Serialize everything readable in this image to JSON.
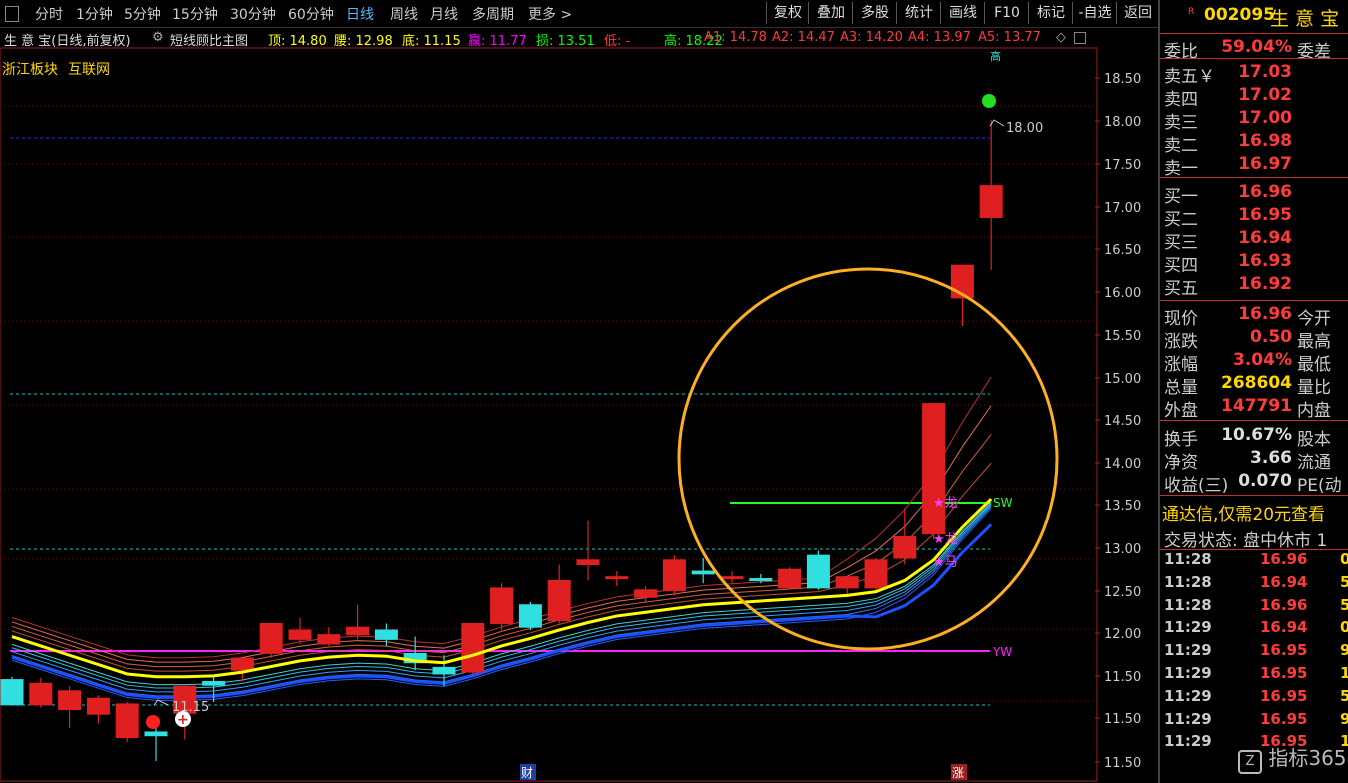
{
  "toolbar": {
    "periods": [
      "分时",
      "1分钟",
      "5分钟",
      "15分钟",
      "30分钟",
      "60分钟",
      "日线",
      "周线",
      "月线",
      "多周期",
      "更多 >"
    ],
    "active_period": "日线",
    "buttons": [
      "复权",
      "叠加",
      "多股",
      "统计",
      "画线",
      "F10",
      "标记",
      "-自选",
      "返回"
    ]
  },
  "info": {
    "title": "生 意 宝(日线,前复权)",
    "indicator": "短线顾比主图",
    "items": [
      {
        "text": "顶: 14.80",
        "color": "#ffff00"
      },
      {
        "text": "腰: 12.98",
        "color": "#ffff00"
      },
      {
        "text": "底: 11.15",
        "color": "#ffff00"
      },
      {
        "text": "赢: 11.77",
        "color": "#ff00ff"
      },
      {
        "text": "损: 13.51",
        "color": "#00ff00"
      },
      {
        "text": "低: -",
        "color": "#ff3b3b"
      },
      {
        "text": "高: 18.22",
        "color": "#00ff00"
      },
      {
        "text": "A1: 14.78",
        "color": "#ff3b3b"
      },
      {
        "text": "A2: 14.47",
        "color": "#ff3b3b"
      },
      {
        "text": "A3: 14.20",
        "color": "#ff3b3b"
      },
      {
        "text": "A4: 13.97",
        "color": "#ff3b3b"
      },
      {
        "text": "A5: 13.77",
        "color": "#ff3b3b"
      }
    ]
  },
  "sectors": [
    "浙江板块",
    "互联网"
  ],
  "chart_data": {
    "type": "candlestick",
    "ylim": [
      11.0,
      18.75
    ],
    "y_ticks": [
      "18.50",
      "18.00",
      "17.50",
      "17.00",
      "16.50",
      "16.00",
      "15.50",
      "15.00",
      "14.50",
      "14.00",
      "13.50",
      "13.00",
      "12.50",
      "12.00",
      "11.50",
      "11.50",
      "11.50"
    ],
    "candles": [
      {
        "o": 12.02,
        "h": 12.05,
        "l": 11.75,
        "c": 11.75
      },
      {
        "o": 11.75,
        "h": 12.04,
        "l": 11.72,
        "c": 11.98
      },
      {
        "o": 11.7,
        "h": 11.95,
        "l": 11.5,
        "c": 11.9
      },
      {
        "o": 11.65,
        "h": 11.85,
        "l": 11.55,
        "c": 11.82
      },
      {
        "o": 11.4,
        "h": 11.78,
        "l": 11.35,
        "c": 11.76
      },
      {
        "o": 11.46,
        "h": 11.52,
        "l": 11.15,
        "c": 11.42
      },
      {
        "o": 11.66,
        "h": 11.95,
        "l": 11.38,
        "c": 11.95
      },
      {
        "o": 12.0,
        "h": 12.07,
        "l": 11.78,
        "c": 11.96
      },
      {
        "o": 12.12,
        "h": 12.25,
        "l": 12.0,
        "c": 12.25
      },
      {
        "o": 12.3,
        "h": 12.62,
        "l": 12.25,
        "c": 12.62
      },
      {
        "o": 12.45,
        "h": 12.68,
        "l": 12.4,
        "c": 12.55
      },
      {
        "o": 12.4,
        "h": 12.58,
        "l": 12.38,
        "c": 12.5
      },
      {
        "o": 12.5,
        "h": 12.82,
        "l": 12.45,
        "c": 12.58
      },
      {
        "o": 12.55,
        "h": 12.62,
        "l": 12.38,
        "c": 12.45
      },
      {
        "o": 12.3,
        "h": 12.48,
        "l": 12.12,
        "c": 12.2
      },
      {
        "o": 12.15,
        "h": 12.28,
        "l": 11.95,
        "c": 12.08
      },
      {
        "o": 12.1,
        "h": 12.62,
        "l": 12.08,
        "c": 12.62
      },
      {
        "o": 12.62,
        "h": 13.05,
        "l": 12.55,
        "c": 13.0
      },
      {
        "o": 12.82,
        "h": 12.85,
        "l": 12.55,
        "c": 12.58
      },
      {
        "o": 12.65,
        "h": 13.25,
        "l": 12.62,
        "c": 13.08
      },
      {
        "o": 13.25,
        "h": 13.72,
        "l": 13.08,
        "c": 13.3
      },
      {
        "o": 13.1,
        "h": 13.18,
        "l": 13.02,
        "c": 13.12
      },
      {
        "o": 12.9,
        "h": 13.02,
        "l": 12.85,
        "c": 12.98
      },
      {
        "o": 12.97,
        "h": 13.35,
        "l": 12.92,
        "c": 13.3
      },
      {
        "o": 13.18,
        "h": 13.32,
        "l": 13.05,
        "c": 13.15
      },
      {
        "o": 13.1,
        "h": 13.18,
        "l": 13.05,
        "c": 13.12
      },
      {
        "o": 13.1,
        "h": 13.15,
        "l": 13.05,
        "c": 13.08
      },
      {
        "o": 13.0,
        "h": 13.22,
        "l": 12.98,
        "c": 13.2
      },
      {
        "o": 13.35,
        "h": 13.4,
        "l": 12.98,
        "c": 13.0
      },
      {
        "o": 13.0,
        "h": 13.12,
        "l": 12.9,
        "c": 13.12
      },
      {
        "o": 13.0,
        "h": 13.32,
        "l": 12.95,
        "c": 13.3
      },
      {
        "o": 13.32,
        "h": 13.85,
        "l": 13.25,
        "c": 13.55
      },
      {
        "o": 13.58,
        "h": 14.97,
        "l": 13.52,
        "c": 14.97
      },
      {
        "o": 16.1,
        "h": 16.45,
        "l": 15.8,
        "c": 16.45
      },
      {
        "o": 16.96,
        "h": 18.0,
        "l": 16.4,
        "c": 17.3
      }
    ],
    "moving_average_yellow": [
      12.48,
      12.38,
      12.28,
      12.18,
      12.08,
      12.05,
      12.05,
      12.06,
      12.1,
      12.16,
      12.22,
      12.26,
      12.28,
      12.27,
      12.22,
      12.2,
      12.28,
      12.38,
      12.46,
      12.55,
      12.63,
      12.7,
      12.74,
      12.78,
      12.82,
      12.84,
      12.86,
      12.88,
      12.9,
      12.92,
      12.96,
      13.08,
      13.3,
      13.65,
      13.95
    ],
    "level_lines": {
      "top": 14.8,
      "bottom": 11.15,
      "win_yw": 11.77,
      "loss_sw": 13.51,
      "mid": 12.98,
      "peak_dash": 17.8
    },
    "annotations": [
      "18.00",
      "11.15",
      "SW",
      "YW",
      "龙",
      "马",
      "财",
      "涨",
      "高"
    ]
  },
  "sidebar": {
    "code": "002095",
    "name": "生 意 宝",
    "rows": [
      {
        "lbl": "委比",
        "val": "59.04%",
        "color": "#ff3b3b",
        "lbl2": "委差"
      },
      {
        "lbl": "卖五￥",
        "val": "17.03",
        "color": "#ff3b3b"
      },
      {
        "lbl": "卖四",
        "val": "17.02",
        "color": "#ff3b3b"
      },
      {
        "lbl": "卖三",
        "val": "17.00",
        "color": "#ff3b3b"
      },
      {
        "lbl": "卖二",
        "val": "16.98",
        "color": "#ff3b3b"
      },
      {
        "lbl": "卖一",
        "val": "16.97",
        "color": "#ff3b3b"
      },
      {
        "lbl": "买一",
        "val": "16.96",
        "color": "#ff3b3b"
      },
      {
        "lbl": "买二",
        "val": "16.95",
        "color": "#ff3b3b"
      },
      {
        "lbl": "买三",
        "val": "16.94",
        "color": "#ff3b3b"
      },
      {
        "lbl": "买四",
        "val": "16.93",
        "color": "#ff3b3b"
      },
      {
        "lbl": "买五",
        "val": "16.92",
        "color": "#ff3b3b"
      },
      {
        "lbl": "现价",
        "val": "16.96",
        "color": "#ff3b3b",
        "lbl2": "今开"
      },
      {
        "lbl": "涨跌",
        "val": "0.50",
        "color": "#ff3b3b",
        "lbl2": "最高"
      },
      {
        "lbl": "涨幅",
        "val": "3.04%",
        "color": "#ff3b3b",
        "lbl2": "最低"
      },
      {
        "lbl": "总量",
        "val": "268604",
        "color": "#ffd700",
        "lbl2": "量比"
      },
      {
        "lbl": "外盘",
        "val": "147791",
        "color": "#ff3b3b",
        "lbl2": "内盘"
      },
      {
        "lbl": "换手",
        "val": "10.67%",
        "color": "#ddd",
        "lbl2": "股本"
      },
      {
        "lbl": "净资",
        "val": "3.66",
        "color": "#ddd",
        "lbl2": "流通"
      },
      {
        "lbl": "收益(三)",
        "val": "0.070",
        "color": "#ddd",
        "lbl2": "PE(动"
      }
    ],
    "promo": "通达信,仅需20元查看",
    "status": "交易状态: 盘中休市  1",
    "trades": [
      {
        "t": "11:28",
        "p": "16.96",
        "v": "0"
      },
      {
        "t": "11:28",
        "p": "16.94",
        "v": "52"
      },
      {
        "t": "11:28",
        "p": "16.96",
        "v": "5"
      },
      {
        "t": "11:29",
        "p": "16.94",
        "v": "0"
      },
      {
        "t": "11:29",
        "p": "16.95",
        "v": "9"
      },
      {
        "t": "11:29",
        "p": "16.95",
        "v": "1"
      },
      {
        "t": "11:29",
        "p": "16.95",
        "v": "5"
      },
      {
        "t": "11:29",
        "p": "16.95",
        "v": "9"
      },
      {
        "t": "11:29",
        "p": "16.95",
        "v": "1"
      }
    ],
    "watermark": "指标365"
  }
}
